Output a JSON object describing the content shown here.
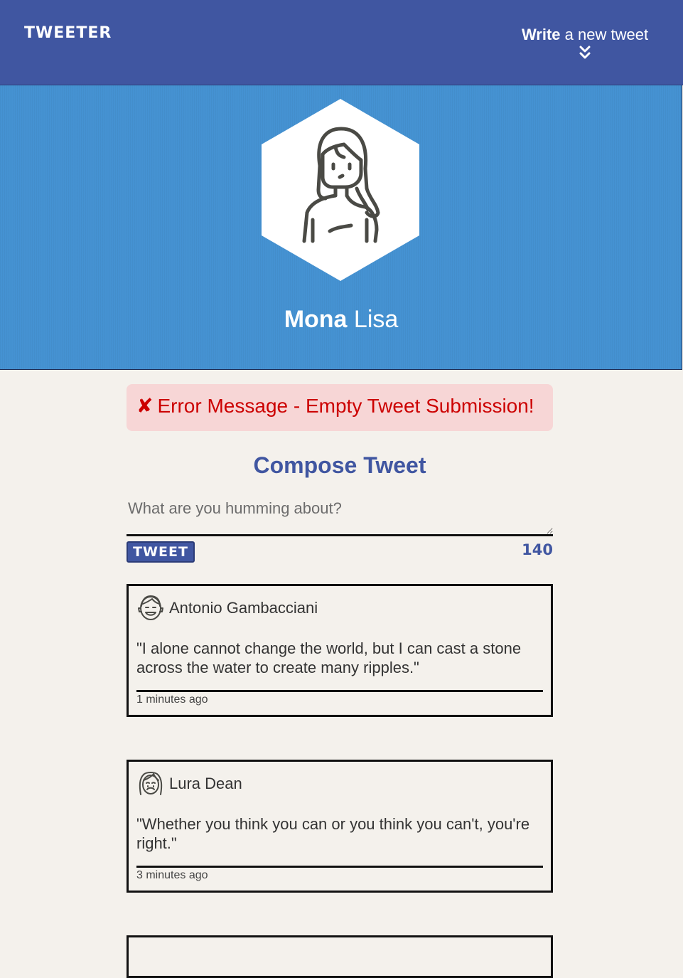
{
  "nav": {
    "brand": "TWEETER",
    "compose_bold": "Write",
    "compose_rest": " a new tweet",
    "compose_icon": "double-chevron-down-icon"
  },
  "profile": {
    "first_name": "Mona",
    "last_name": "Lisa",
    "avatar_icon": "woman-avatar-icon"
  },
  "error": {
    "icon": "✘",
    "message": "Error Message - Empty Tweet Submission!"
  },
  "compose": {
    "title": "Compose Tweet",
    "placeholder": "What are you humming about?",
    "submit_label": "TWEET",
    "counter": "140"
  },
  "tweets": [
    {
      "author": "Antonio Gambacciani",
      "avatar_icon": "smiling-man-avatar-icon",
      "text": "\"I alone cannot change the world, but I can cast a stone across the water to create many ripples.\"",
      "time": "1 minutes ago"
    },
    {
      "author": "Lura Dean",
      "avatar_icon": "frowning-woman-avatar-icon",
      "text": "\"Whether you think you can or you think you can't, you're right.\"",
      "time": "3 minutes ago"
    }
  ],
  "colors": {
    "nav": "#4056a1",
    "header": "#4592d2",
    "background": "#f4f1ec",
    "error_bg": "#f7d6d6",
    "error_text": "#cc0000"
  }
}
